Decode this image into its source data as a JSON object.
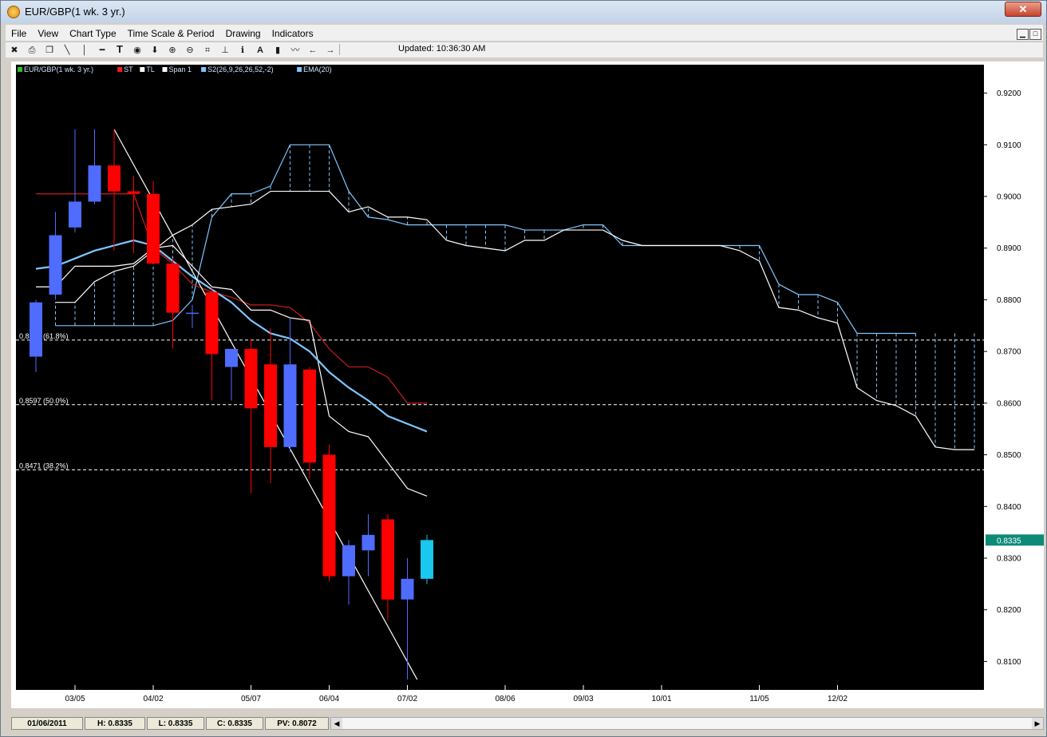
{
  "window": {
    "title": "EUR/GBP(1 wk.  3 yr.)",
    "close_label": "✕",
    "mdi_min": "▁",
    "mdi_max": "□"
  },
  "menu": [
    "File",
    "View",
    "Chart Type",
    "Time Scale & Period",
    "Drawing",
    "Indicators"
  ],
  "toolbar": {
    "icons": [
      "delete-icon",
      "print-icon",
      "copy-icon",
      "trendline-icon",
      "vertical-line-icon",
      "horizontal-line-icon",
      "text-icon",
      "target-icon",
      "down-arrow-icon",
      "zoom-in-icon",
      "zoom-out-icon",
      "fit-icon",
      "fibonacci-icon",
      "info-icon",
      "label-icon",
      "bar-chart-icon",
      "line-chart-icon",
      "arrow-left-icon",
      "arrow-right-icon"
    ],
    "updated": "Updated: 10:36:30 AM"
  },
  "legend": [
    {
      "label": "EUR/GBP(1 wk.  3 yr.)",
      "color": "#26c726"
    },
    {
      "label": "ST",
      "color": "#ff1a1a"
    },
    {
      "label": "TL",
      "color": "#ffffff"
    },
    {
      "label": "Span 1",
      "color": "#ffffff"
    },
    {
      "label": "S2(26,9,26,26,52,-2)",
      "color": "#7fc6ff"
    },
    {
      "label": "EMA(20)",
      "color": "#7fc6ff"
    }
  ],
  "status": {
    "date": "01/06/2011",
    "high": "H: 0.8335",
    "low": "L: 0.8335",
    "close": "C: 0.8335",
    "pv": "PV: 0.8072"
  },
  "colors": {
    "bull": "#4f6cff",
    "bear": "#ff0000",
    "last": "#1ac7ef",
    "st": "#cc1b1b",
    "white": "#ffffff",
    "blue_line": "#7fc6ff",
    "price_badge": "#0e8a78"
  },
  "chart_data": {
    "type": "candlestick",
    "ylim": [
      0.8045,
      0.9255
    ],
    "y_ticks": [
      "0.9200",
      "0.9100",
      "0.9000",
      "0.8900",
      "0.8800",
      "0.8700",
      "0.8600",
      "0.8500",
      "0.8400",
      "0.8300",
      "0.8200",
      "0.8100"
    ],
    "x_ticks": [
      {
        "i": 2,
        "label": "03/05"
      },
      {
        "i": 6,
        "label": "04/02"
      },
      {
        "i": 11,
        "label": "05/07"
      },
      {
        "i": 15,
        "label": "06/04"
      },
      {
        "i": 19,
        "label": "07/02"
      },
      {
        "i": 24,
        "label": "08/06"
      },
      {
        "i": 28,
        "label": "09/03"
      },
      {
        "i": 32,
        "label": "10/01"
      },
      {
        "i": 37,
        "label": "11/05"
      },
      {
        "i": 41,
        "label": "12/02"
      }
    ],
    "current_price": "0.8335",
    "fib_levels": [
      {
        "value": 0.8722,
        "label": "0.8722 (61.8%)"
      },
      {
        "value": 0.8597,
        "label": "0.8597 (50.0%)"
      },
      {
        "value": 0.8471,
        "label": "0.8471 (38.2%)"
      }
    ],
    "candles": [
      {
        "o": 0.869,
        "h": 0.88,
        "l": 0.866,
        "c": 0.8795
      },
      {
        "o": 0.881,
        "h": 0.897,
        "l": 0.88,
        "c": 0.8925
      },
      {
        "o": 0.894,
        "h": 0.913,
        "l": 0.893,
        "c": 0.899
      },
      {
        "o": 0.899,
        "h": 0.913,
        "l": 0.8985,
        "c": 0.906
      },
      {
        "o": 0.906,
        "h": 0.913,
        "l": 0.8895,
        "c": 0.901
      },
      {
        "o": 0.901,
        "h": 0.904,
        "l": 0.889,
        "c": 0.9005
      },
      {
        "o": 0.9005,
        "h": 0.903,
        "l": 0.887,
        "c": 0.887
      },
      {
        "o": 0.887,
        "h": 0.888,
        "l": 0.8705,
        "c": 0.8775
      },
      {
        "o": 0.8775,
        "h": 0.879,
        "l": 0.8745,
        "c": 0.8775
      },
      {
        "o": 0.8815,
        "h": 0.8825,
        "l": 0.8605,
        "c": 0.8695
      },
      {
        "o": 0.867,
        "h": 0.87,
        "l": 0.8605,
        "c": 0.8705
      },
      {
        "o": 0.8705,
        "h": 0.8725,
        "l": 0.8425,
        "c": 0.859
      },
      {
        "o": 0.8675,
        "h": 0.8745,
        "l": 0.8445,
        "c": 0.8515
      },
      {
        "o": 0.8515,
        "h": 0.8765,
        "l": 0.8505,
        "c": 0.8675
      },
      {
        "o": 0.8665,
        "h": 0.867,
        "l": 0.8455,
        "c": 0.8485
      },
      {
        "o": 0.85,
        "h": 0.852,
        "l": 0.8255,
        "c": 0.8265
      },
      {
        "o": 0.8265,
        "h": 0.8335,
        "l": 0.821,
        "c": 0.8325
      },
      {
        "o": 0.8315,
        "h": 0.8385,
        "l": 0.8265,
        "c": 0.8345
      },
      {
        "o": 0.8375,
        "h": 0.8385,
        "l": 0.818,
        "c": 0.822
      },
      {
        "o": 0.822,
        "h": 0.83,
        "l": 0.8065,
        "c": 0.826
      },
      {
        "o": 0.826,
        "h": 0.8345,
        "l": 0.825,
        "c": 0.8335
      }
    ],
    "ema20": [
      0.886,
      0.8865,
      0.888,
      0.8895,
      0.8905,
      0.8915,
      0.8905,
      0.8875,
      0.8845,
      0.882,
      0.8795,
      0.876,
      0.8735,
      0.8725,
      0.87,
      0.866,
      0.863,
      0.8605,
      0.8575,
      0.856,
      0.8545
    ],
    "st_line": [
      0.9005,
      0.9005,
      0.9005,
      0.9005,
      0.9005,
      0.9005,
      0.89,
      0.887,
      0.883,
      0.8815,
      0.8805,
      0.879,
      0.879,
      0.8785,
      0.8755,
      0.8705,
      0.867,
      0.867,
      0.865,
      0.86,
      0.86
    ],
    "tl_line": [
      0.8825,
      0.8825,
      0.8865,
      0.8865,
      0.8865,
      0.887,
      0.89,
      0.8905,
      0.8865,
      0.8825,
      0.882,
      0.878,
      0.878,
      0.8765,
      0.876,
      0.8575,
      0.8545,
      0.8535,
      0.8485,
      0.8435,
      0.842
    ],
    "trendline": [
      {
        "i": 4,
        "v": 0.913
      },
      {
        "i": 19.5,
        "v": 0.8065
      }
    ],
    "cloud": {
      "start": 1,
      "span_a": [
        0.875,
        0.875,
        0.875,
        0.875,
        0.875,
        0.875,
        0.876,
        0.88,
        0.896,
        0.9005,
        0.9005,
        0.902,
        0.91,
        0.91,
        0.91,
        0.901,
        0.896,
        0.8955,
        0.8945,
        0.8945,
        0.8945,
        0.8945,
        0.8945,
        0.8945,
        0.8935,
        0.8935,
        0.8935,
        0.8945,
        0.8945,
        0.8905,
        0.8905,
        0.8905,
        0.8905,
        0.8905,
        0.8905,
        0.8905,
        0.8905,
        0.883,
        0.881,
        0.881,
        0.8795,
        0.8735,
        0.8735,
        0.8735,
        0.8735
      ],
      "span_b": [
        0.8795,
        0.8795,
        0.8835,
        0.8855,
        0.8865,
        0.8895,
        0.8925,
        0.8945,
        0.8975,
        0.898,
        0.8985,
        0.901,
        0.901,
        0.901,
        0.901,
        0.897,
        0.898,
        0.896,
        0.896,
        0.8955,
        0.8915,
        0.8905,
        0.89,
        0.8895,
        0.8915,
        0.8915,
        0.8935,
        0.8935,
        0.8935,
        0.8915,
        0.8905,
        0.8905,
        0.8905,
        0.8905,
        0.8905,
        0.8895,
        0.8875,
        0.8785,
        0.878,
        0.8765,
        0.8755,
        0.863,
        0.8605,
        0.8595,
        0.8575,
        0.8515,
        0.851,
        0.851
      ]
    }
  }
}
